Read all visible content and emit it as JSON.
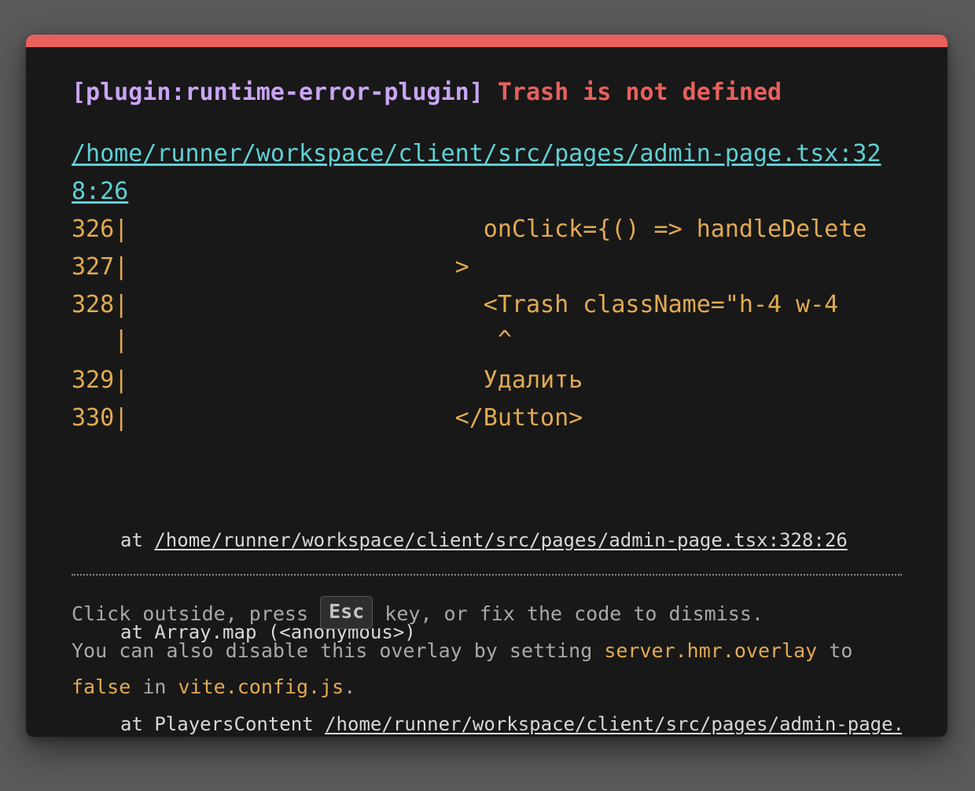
{
  "error": {
    "plugin": "[plugin:runtime-error-plugin]",
    "message": "Trash is not defined",
    "file": "/home/runner/workspace/client/src/pages/admin-page.tsx:328:26"
  },
  "frame_lines": [
    "326|                         onClick={() => handleDelete",
    "327|                       >",
    "328|                         <Trash className=\"h-4 w-4",
    "   |                          ^",
    "329|                         Удалить",
    "330|                       </Button>"
  ],
  "stack": {
    "line1_prefix": "at ",
    "line1_link": "/home/runner/workspace/client/src/pages/admin-page.tsx:328:26",
    "line2": "at Array.map (<anonymous>)",
    "line3_prefix": "at PlayersContent ",
    "line3_link": "/home/runner/workspace/client/src/pages/admin-page.tsx"
  },
  "tip": {
    "part1": "Click outside, press ",
    "key": "Esc",
    "part2": " key, or fix the code to dismiss.",
    "part3": "You can also disable this overlay by setting ",
    "setting": "server.hmr.overlay",
    "part4": " to",
    "value": "false",
    "part5": " in ",
    "config_file": "vite.config.js",
    "part6": "."
  },
  "colors": {
    "accent_bar": "#e8605c",
    "plugin": "#c9a5f5",
    "error": "#e8605c",
    "file_link": "#5fd0d4",
    "code": "#e2aa53"
  }
}
